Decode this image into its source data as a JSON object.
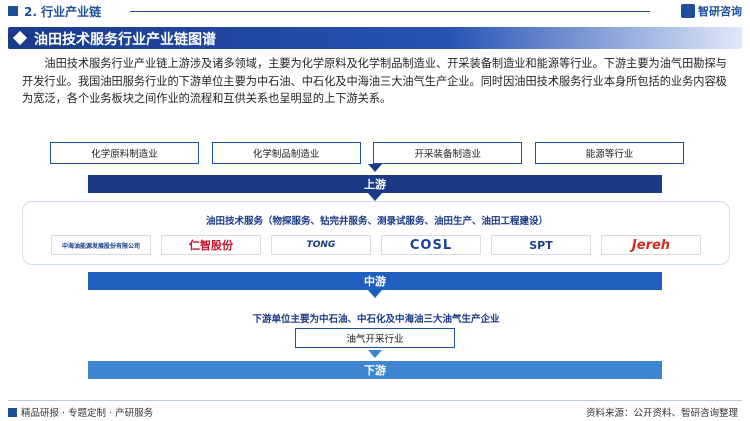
{
  "header": {
    "section_title": "2. 行业产业链",
    "logo_text": "智研咨询"
  },
  "banner": {
    "title": "油田技术服务行业产业链图谱"
  },
  "intro": {
    "text": "油田技术服务行业产业链上游涉及诸多领域，主要为化学原料及化学制品制造业、开采装备制造业和能源等行业。下游主要为油气田勘探与开发行业。我国油田服务行业的下游单位主要为中石油、中石化及中海油三大油气生产企业。同时因油田技术服务行业本身所包括的业务内容极为宽泛，各个业务板块之间作业的流程和互供关系也呈明显的上下游关系。"
  },
  "upstream": {
    "categories": [
      "化学原料制造业",
      "化学制品制造业",
      "开采装备制造业",
      "能源等行业"
    ],
    "label": "上游"
  },
  "midstream": {
    "caption": "油田技术服务（物探服务、钻完井服务、测录试服务、油田生产、油田工程建设）",
    "companies": [
      "中海油能源发展股份有限公司",
      "仁智股份",
      "TONG",
      "COSL",
      "SPT",
      "Jereh"
    ],
    "label": "中游"
  },
  "downstream": {
    "caption": "下游单位主要为中石油、中石化及中海油三大油气生产企业",
    "industry": "油气开采行业",
    "label": "下游"
  },
  "footer": {
    "left_text": "精品研报 · 专题定制 · 产研服务",
    "source": "资料来源：公开资料、智研咨询整理"
  }
}
